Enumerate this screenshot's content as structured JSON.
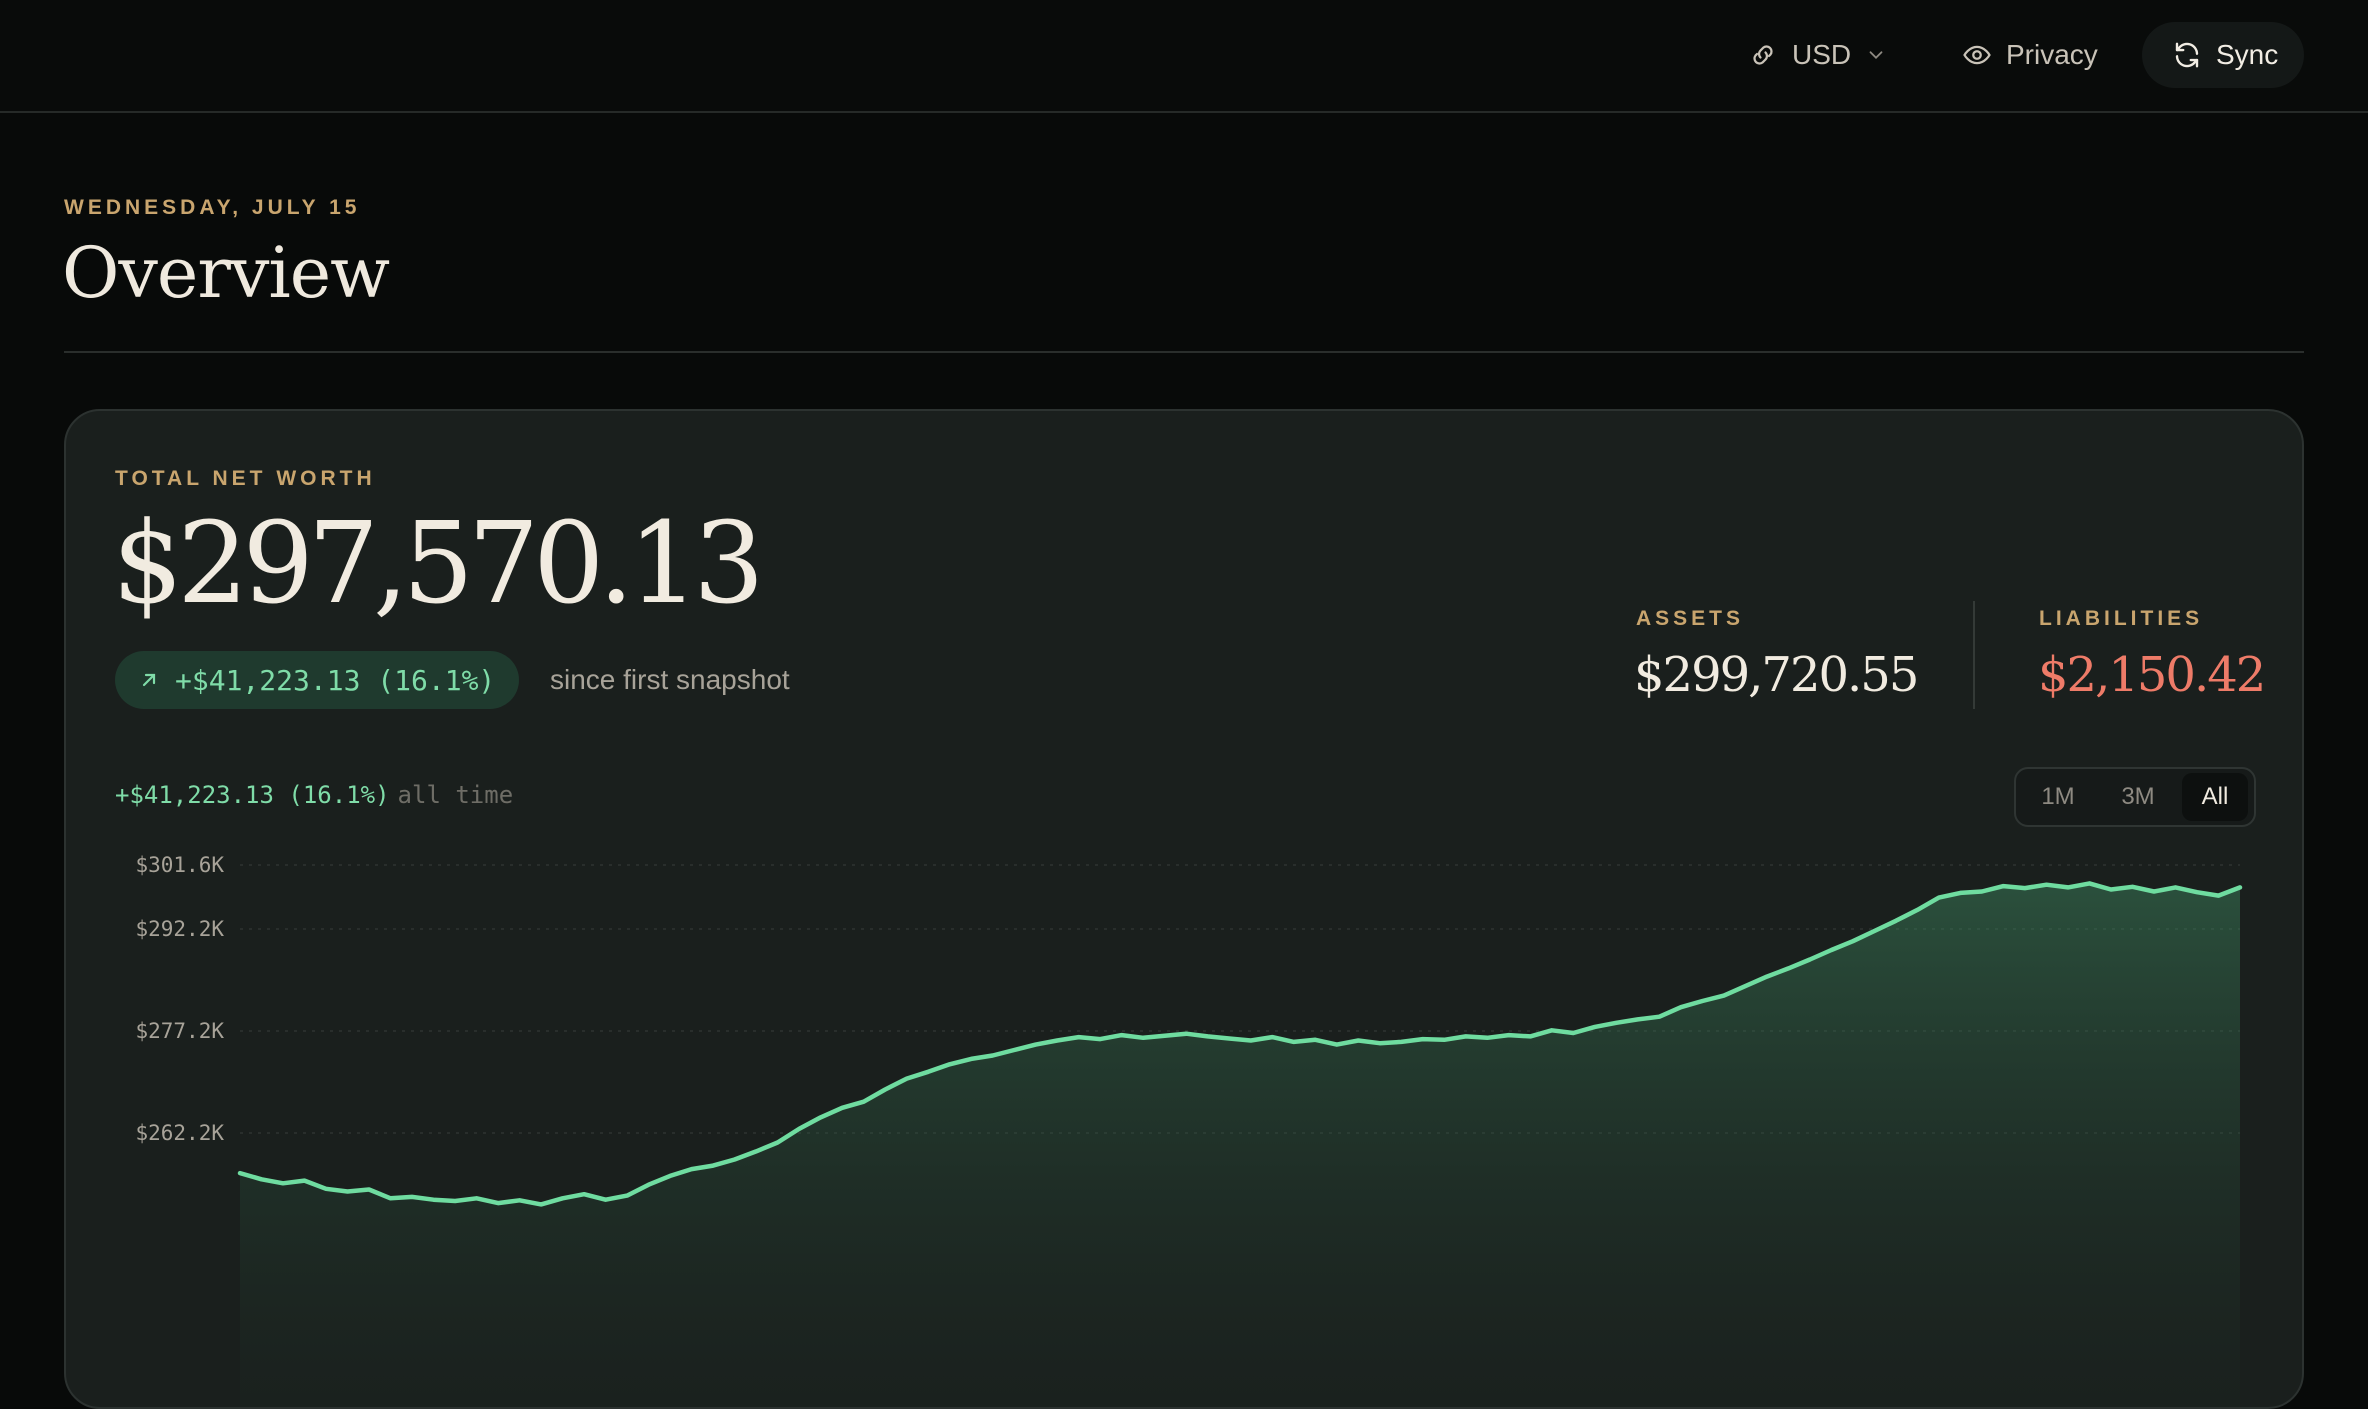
{
  "topbar": {
    "currency_label": "USD",
    "currency_icon": "link-icon",
    "privacy_label": "Privacy",
    "privacy_icon": "eye-icon",
    "sync_label": "Sync",
    "sync_icon": "refresh-icon"
  },
  "header": {
    "date": "WEDNESDAY, JULY 15",
    "title": "Overview"
  },
  "net_worth": {
    "label": "TOTAL NET WORTH",
    "value": "$297,570.13",
    "change": "+$41,223.13 (16.1%)",
    "change_icon": "arrow-up-right-icon",
    "since": "since first snapshot"
  },
  "assets": {
    "label": "ASSETS",
    "value": "$299,720.55"
  },
  "liabilities": {
    "label": "LIABILITIES",
    "value": "$2,150.42"
  },
  "chart_header": {
    "change": "+$41,223.13 (16.1%)",
    "period": "all time"
  },
  "range": {
    "options": [
      "1M",
      "3M",
      "All"
    ],
    "selected": "All"
  },
  "colors": {
    "accent_green": "#6fdca0",
    "liability_red": "#ee7b68",
    "label_gold": "#c9a56e"
  },
  "chart_data": {
    "type": "area",
    "title": "",
    "xlabel": "",
    "ylabel": "",
    "y_ticks": [
      "$301.6K",
      "$292.2K",
      "$277.2K",
      "$262.2K"
    ],
    "y_tick_values": [
      301.6,
      292.2,
      277.2,
      262.2
    ],
    "ylim": [
      249,
      302
    ],
    "grid": true,
    "series": [
      {
        "values": [
          256.3,
          255.4,
          254.8,
          255.2,
          254.0,
          253.6,
          253.9,
          252.6,
          252.8,
          252.4,
          252.2,
          252.6,
          251.9,
          252.3,
          251.7,
          252.6,
          253.2,
          252.4,
          253.0,
          254.6,
          255.9,
          256.9,
          257.4,
          258.3,
          259.5,
          260.8,
          262.8,
          264.5,
          265.9,
          266.8,
          268.6,
          270.2,
          271.2,
          272.3,
          273.1,
          273.6,
          274.4,
          275.2,
          275.8,
          276.3,
          276.0,
          276.6,
          276.2,
          276.5,
          276.8,
          276.4,
          276.1,
          275.8,
          276.3,
          275.6,
          275.9,
          275.2,
          275.8,
          275.4,
          275.6,
          276.0,
          275.9,
          276.4,
          276.2,
          276.6,
          276.4,
          277.3,
          276.9,
          277.8,
          278.4,
          278.9,
          279.3,
          280.7,
          281.6,
          282.4,
          283.8,
          285.2,
          286.4,
          287.7,
          289.1,
          290.4,
          291.9,
          293.4,
          295.0,
          296.8,
          297.5,
          297.7,
          298.5,
          298.2,
          298.7,
          298.3,
          298.9,
          298.0,
          298.4,
          297.7,
          298.3,
          297.6,
          297.1,
          298.3
        ]
      }
    ]
  }
}
